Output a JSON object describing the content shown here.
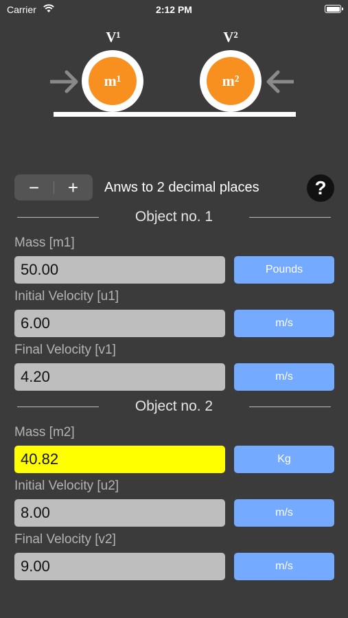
{
  "status": {
    "carrier": "Carrier",
    "time": "2:12 PM"
  },
  "diagram": {
    "v1_label": "V¹",
    "v2_label": "V²",
    "m1_label": "m¹",
    "m2_label": "m²",
    "ball_color": "#f7901e"
  },
  "controls": {
    "minus": "−",
    "plus": "+",
    "decimals_text": "Anws to 2 decimal places",
    "help": "?"
  },
  "object1": {
    "title": "Object no. 1",
    "mass": {
      "label": "Mass [m1]",
      "value": "50.00",
      "unit": "Pounds"
    },
    "initial_velocity": {
      "label": "Initial Velocity [u1]",
      "value": "6.00",
      "unit": "m/s"
    },
    "final_velocity": {
      "label": "Final Velocity [v1]",
      "value": "4.20",
      "unit": "m/s"
    }
  },
  "object2": {
    "title": "Object no. 2",
    "mass": {
      "label": "Mass [m2]",
      "value": "40.82",
      "unit": "Kg"
    },
    "initial_velocity": {
      "label": "Initial Velocity [u2]",
      "value": "8.00",
      "unit": "m/s"
    },
    "final_velocity": {
      "label": "Final Velocity [v2]",
      "value": "9.00",
      "unit": "m/s"
    }
  },
  "colors": {
    "background": "#3b3b3b",
    "field": "#bebebe",
    "highlight": "#ffff00",
    "unit_button": "#74aaff"
  }
}
